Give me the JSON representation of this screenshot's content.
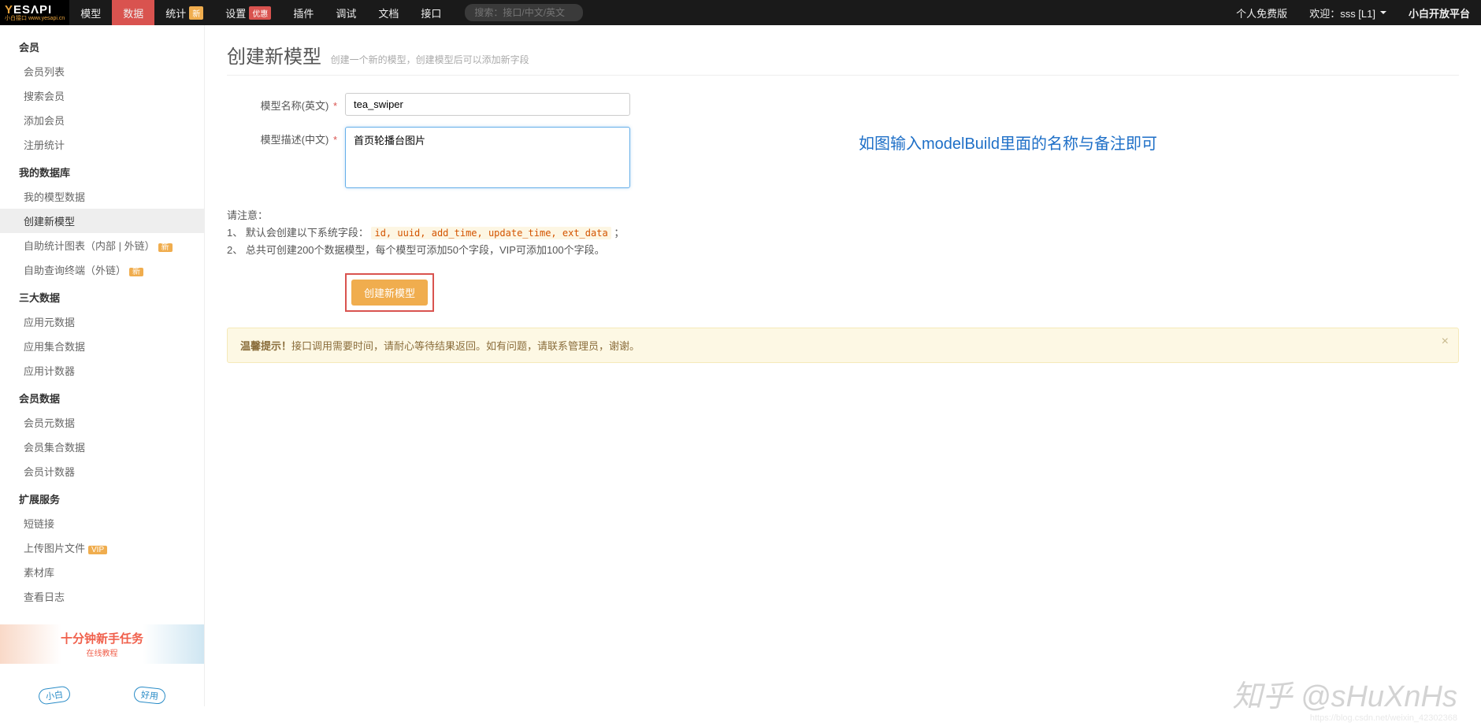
{
  "brand": {
    "name_highlight": "Y",
    "name_rest": "ESΛPI",
    "sub": "小白接口 www.yesapi.cn"
  },
  "nav": {
    "items": [
      {
        "label": "模型"
      },
      {
        "label": "数据",
        "active": true
      },
      {
        "label": "统计",
        "badge_new": "新"
      },
      {
        "label": "设置",
        "badge_deal": "优惠"
      },
      {
        "label": "插件"
      },
      {
        "label": "调试"
      },
      {
        "label": "文档"
      },
      {
        "label": "接口"
      }
    ],
    "search_placeholder": "搜索：接口/中文/英文"
  },
  "nav_right": {
    "free": "个人免费版",
    "welcome": "欢迎：sss [L1]",
    "platform": "小白开放平台"
  },
  "sidebar": {
    "groups": [
      {
        "title": "会员",
        "items": [
          {
            "label": "会员列表"
          },
          {
            "label": "搜索会员"
          },
          {
            "label": "添加会员"
          },
          {
            "label": "注册统计"
          }
        ]
      },
      {
        "title": "我的数据库",
        "items": [
          {
            "label": "我的模型数据"
          },
          {
            "label": "创建新模型",
            "active": true
          },
          {
            "label": "自助统计图表（内部 | 外链）",
            "badge_new": "新"
          },
          {
            "label": "自助查询终端（外链）",
            "badge_new": "新"
          }
        ]
      },
      {
        "title": "三大数据",
        "items": [
          {
            "label": "应用元数据"
          },
          {
            "label": "应用集合数据"
          },
          {
            "label": "应用计数器"
          }
        ]
      },
      {
        "title": "会员数据",
        "items": [
          {
            "label": "会员元数据"
          },
          {
            "label": "会员集合数据"
          },
          {
            "label": "会员计数器"
          }
        ]
      },
      {
        "title": "扩展服务",
        "items": [
          {
            "label": "短链接"
          },
          {
            "label": "上传图片文件",
            "badge_vip": "VIP"
          },
          {
            "label": "素材库"
          },
          {
            "label": "查看日志"
          }
        ]
      }
    ],
    "banner1_title": "十分钟新手任务",
    "banner1_sub": "在线教程",
    "banner2_chip1": "小白",
    "banner2_chip2": "好用"
  },
  "page": {
    "title": "创建新模型",
    "subtitle": "创建一个新的模型，创建模型后可以添加新字段"
  },
  "form": {
    "name_label": "模型名称(英文)",
    "name_value": "tea_swiper",
    "desc_label": "模型描述(中文)",
    "desc_value": "首页轮播台图片",
    "required_mark": "*"
  },
  "annotation": "如图输入modelBuild里面的名称与备注即可",
  "notes": {
    "head": "请注意：",
    "line1_pre": "1、 默认会创建以下系统字段：",
    "line1_code": "id, uuid, add_time, update_time, ext_data",
    "line1_post": "；",
    "line2": "2、 总共可创建200个数据模型，每个模型可添加50个字段，VIP可添加100个字段。"
  },
  "submit_label": "创建新模型",
  "alert": {
    "strong": "温馨提示！",
    "text": "接口调用需要时间，请耐心等待结果返回。如有问题，请联系管理员，谢谢。"
  },
  "watermark": "知乎 @sHuXnHs",
  "watermark_url": "https://blog.csdn.net/weixin_42302368"
}
